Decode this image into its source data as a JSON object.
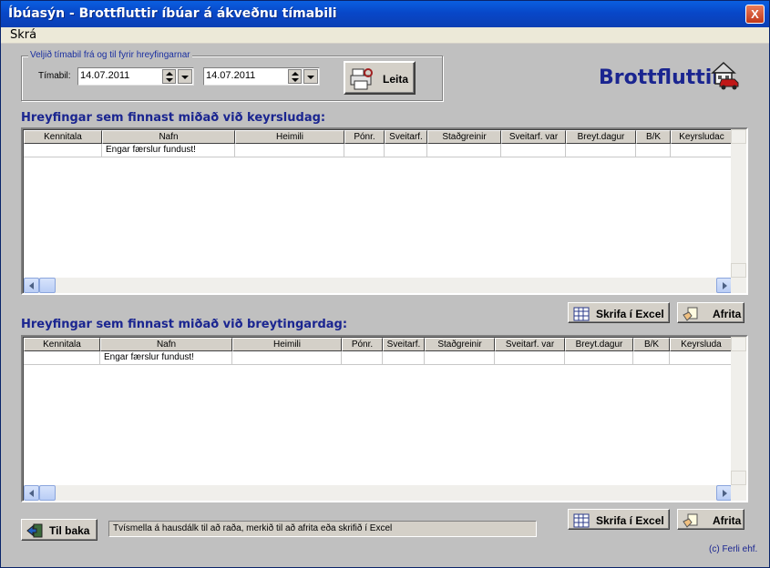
{
  "window": {
    "title": "Íbúasýn - Brottfluttir íbúar á ákveðnu tímabili",
    "close_glyph": "X"
  },
  "menu": {
    "items": [
      {
        "label": "Skrá"
      }
    ]
  },
  "filter": {
    "group_label": "Veljið tímabil frá og til fyrir hreyfingarnar",
    "period_label": "Tímabil:",
    "date_from": "14.07.2011",
    "date_to": "14.07.2011",
    "search_button": "Leita"
  },
  "brand": {
    "label": "Brottfluttir",
    "icon": "house-car-icon"
  },
  "columns": [
    "Kennitala",
    "Nafn",
    "Heimili",
    "Pónr.",
    "Sveitarf.",
    "Staðgreinir",
    "Sveitarf. var",
    "Breyt.dagur",
    "B/K",
    "Keyrsludag"
  ],
  "grid1": {
    "title": "Hreyfingar sem finnast miðað við keyrsludag:",
    "columns": [
      "Kennitala",
      "Nafn",
      "Heimili",
      "Pónr.",
      "Sveitarf.",
      "Staðgreinir",
      "Sveitarf. var",
      "Breyt.dagur",
      "B/K",
      "Keyrsludac"
    ],
    "empty_message": "Engar færslur fundust!"
  },
  "grid2": {
    "title": "Hreyfingar sem finnast miðað við breytingardag:",
    "columns": [
      "Kennitala",
      "Nafn",
      "Heimili",
      "Pónr.",
      "Sveitarf.",
      "Staðgreinir",
      "Sveitarf. var",
      "Breyt.dagur",
      "B/K",
      "Keyrsluda"
    ],
    "empty_message": "Engar færslur fundust!"
  },
  "actions": {
    "excel_label": "Skrifa í Excel",
    "copy_label": "Afrita"
  },
  "footer": {
    "back_label": "Til baka",
    "status_text": "Tvísmella á hausdálk til að raða, merkið til að afrita eða skrifið í Excel",
    "copyright": "(c) Ferli ehf."
  },
  "colors": {
    "title_text": "#1a2590",
    "titlebar": "#0847c8",
    "window_bg": "#c0c0c0"
  }
}
